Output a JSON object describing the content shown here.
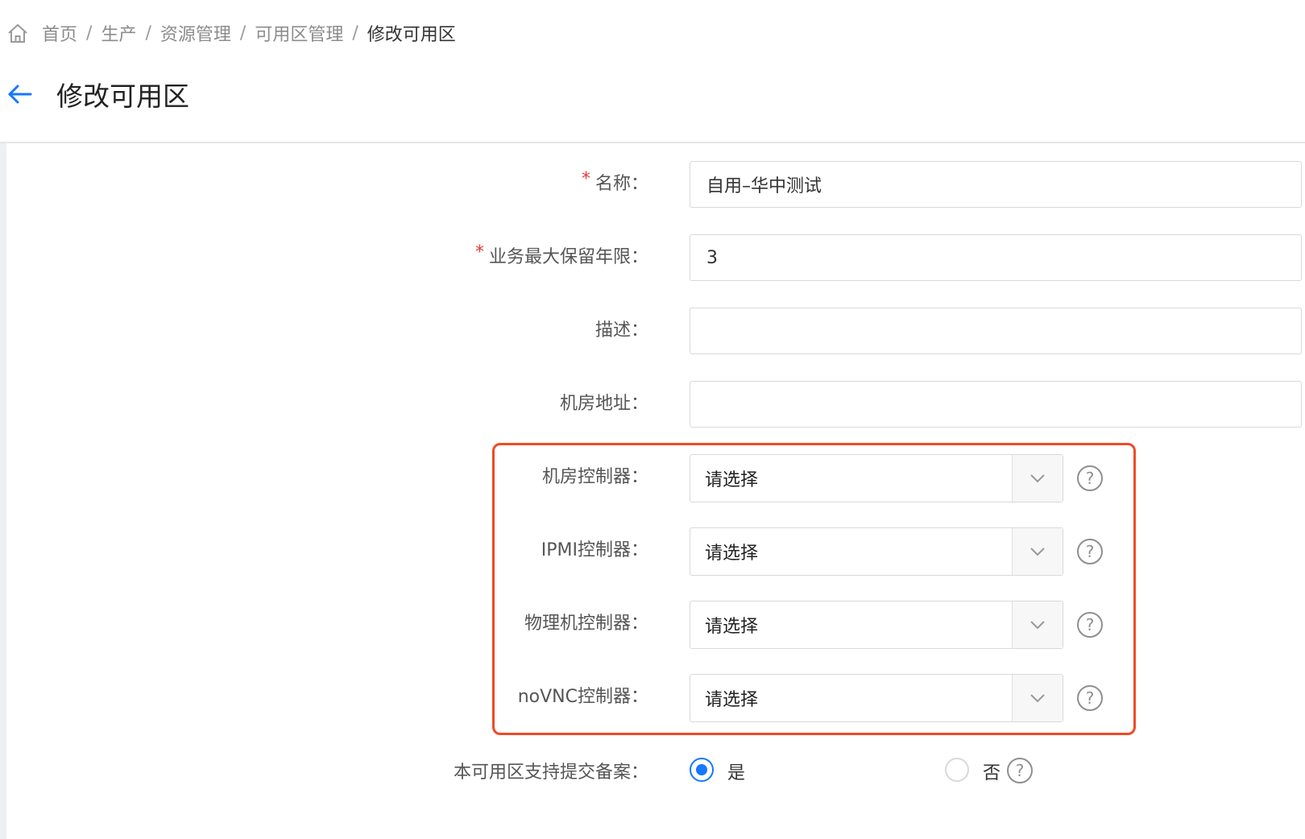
{
  "breadcrumb": {
    "items": [
      "首页",
      "生产",
      "资源管理",
      "可用区管理",
      "修改可用区"
    ],
    "separator": "/"
  },
  "page": {
    "title": "修改可用区"
  },
  "form": {
    "name": {
      "required_mark": "*",
      "label": "名称：",
      "value": "自用–华中测试"
    },
    "retention": {
      "required_mark": "*",
      "label": "业务最大保留年限：",
      "value": "3"
    },
    "description": {
      "label": "描述：",
      "value": ""
    },
    "address": {
      "label": "机房地址：",
      "value": ""
    },
    "room_controller": {
      "label": "机房控制器：",
      "value": "请选择"
    },
    "ipmi_controller": {
      "label": "IPMI控制器：",
      "value": "请选择"
    },
    "physical_controller": {
      "label": "物理机控制器：",
      "value": "请选择"
    },
    "novnc_controller": {
      "label": "noVNC控制器：",
      "value": "请选择"
    },
    "filing": {
      "label": "本可用区支持提交备案：",
      "options": [
        "是",
        "否"
      ],
      "selected": "是"
    },
    "help_glyph": "?"
  },
  "colors": {
    "accent": "#1677ff",
    "highlight_border": "#ef4a27",
    "required": "#e53935"
  },
  "icons": [
    "home-icon",
    "back-arrow-icon",
    "chevron-down-icon",
    "help-icon"
  ]
}
